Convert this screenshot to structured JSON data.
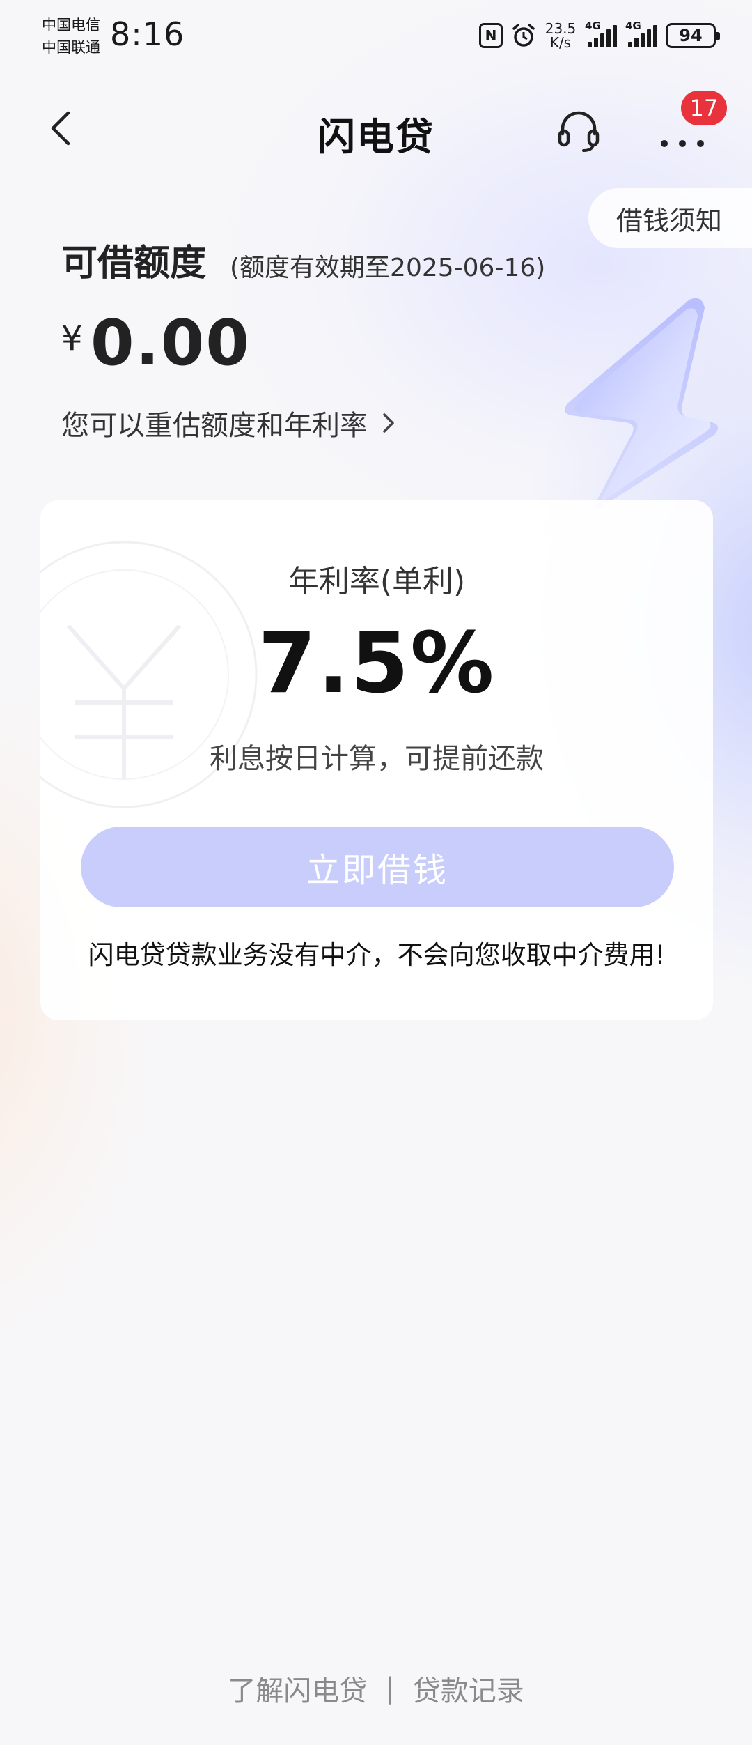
{
  "status_bar": {
    "carrier_1": "中国电信",
    "carrier_2": "中国联通",
    "time": "8:16",
    "nfc": "N",
    "net_speed_value": "23.5",
    "net_speed_unit": "K/s",
    "signal_1_label": "4G",
    "signal_2_label": "4G",
    "battery": "94"
  },
  "nav": {
    "title": "闪电贷",
    "badge_count": "17"
  },
  "notice_tab": "借钱须知",
  "credit": {
    "title": "可借额度",
    "validity": "(额度有效期至2025-06-16)",
    "currency": "¥",
    "amount": "0.00",
    "reassess_link": "您可以重估额度和年利率"
  },
  "card": {
    "rate_label": "年利率(单利)",
    "rate_value": "7.5%",
    "rate_note": "利息按日计算，可提前还款",
    "borrow_button": "立即借钱",
    "disclaimer": "闪电贷贷款业务没有中介，不会向您收取中介费用!"
  },
  "footer": {
    "about_link": "了解闪电贷",
    "separator": "|",
    "records_link": "贷款记录"
  },
  "colors": {
    "accent_button": "#c9cdfb",
    "badge": "#e8323c"
  }
}
